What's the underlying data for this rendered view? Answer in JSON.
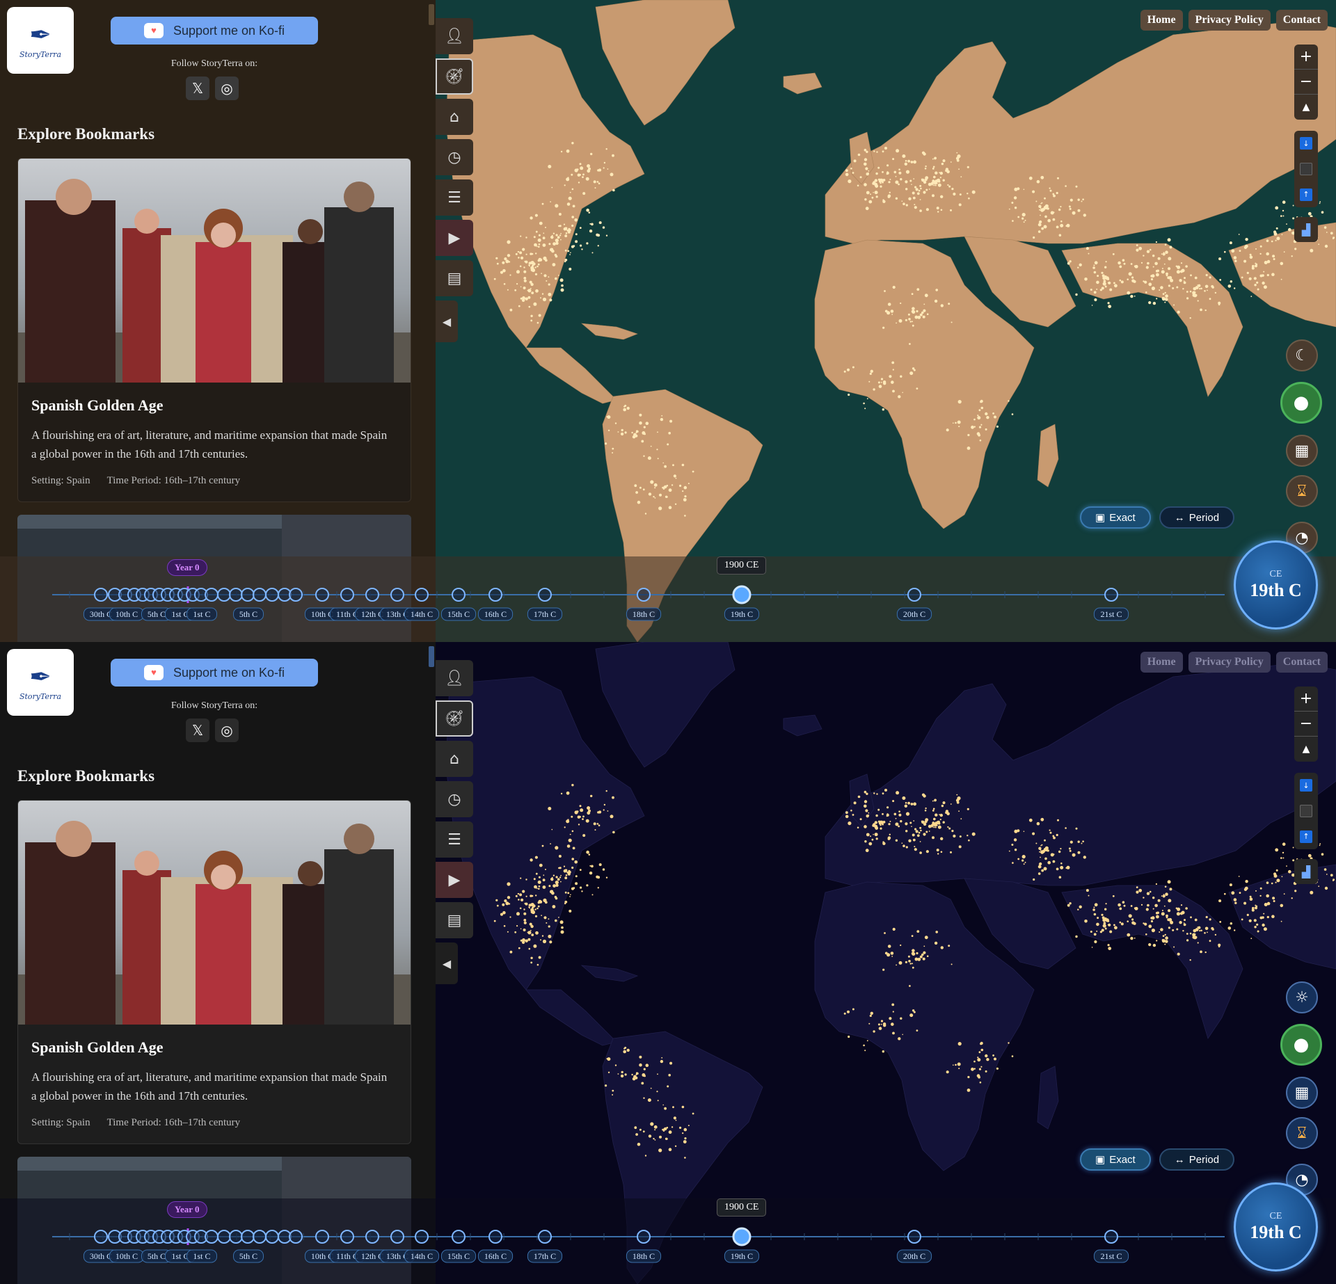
{
  "brand": {
    "logo_text": "StoryTerra"
  },
  "kofi": {
    "label": "Support me on Ko-fi"
  },
  "follow": {
    "label": "Follow StoryTerra on:"
  },
  "socials": [
    {
      "icon": "x-icon"
    },
    {
      "icon": "instagram-icon"
    }
  ],
  "bookmarks": {
    "heading": "Explore Bookmarks",
    "card": {
      "title": "Spanish Golden Age",
      "description": "A flourishing era of art, literature, and maritime expansion that made Spain a global power in the 16th and 17th centuries.",
      "setting": "Setting: Spain",
      "period": "Time Period: 16th–17th century"
    }
  },
  "toolbar": {
    "items": [
      "user-icon",
      "compass-icon",
      "home-icon",
      "clock-icon",
      "menu-icon",
      "youtube-icon",
      "subtitles-icon"
    ],
    "collapse_icon": "chevron-left-icon"
  },
  "nav": {
    "home": "Home",
    "privacy": "Privacy Policy",
    "contact": "Contact"
  },
  "map_controls": {
    "zoom_in": "+",
    "zoom_out": "−",
    "reset_north": "▲",
    "theme_day_icon": "moon-icon",
    "theme_night_icon": "sun-icon"
  },
  "modes": {
    "exact": "Exact",
    "period": "Period",
    "exact_icon": "calendar-icon",
    "period_icon": "arrows-horizontal-icon"
  },
  "timeline": {
    "year0_label": "Year 0",
    "current_year_tooltip": "1900 CE",
    "labels": [
      "30th C",
      "10th C",
      "5th C",
      "1st C",
      "1st C",
      "5th C",
      "10th C",
      "11th C",
      "12th C",
      "13th C",
      "14th C",
      "15th C",
      "16th C",
      "17th C",
      "18th C",
      "19th C",
      "20th C",
      "21st C"
    ],
    "current_label": "19th C"
  },
  "century_badge": {
    "era": "CE",
    "century": "19th C"
  },
  "colors": {
    "day_ocean": "#113d3b",
    "day_land": "#c89a70",
    "night_ocean": "#07061d",
    "night_land": "#131238",
    "accent_blue": "#5aa8ff",
    "kofi_blue": "#72a4f2",
    "user_green": "#2f7d3a"
  }
}
